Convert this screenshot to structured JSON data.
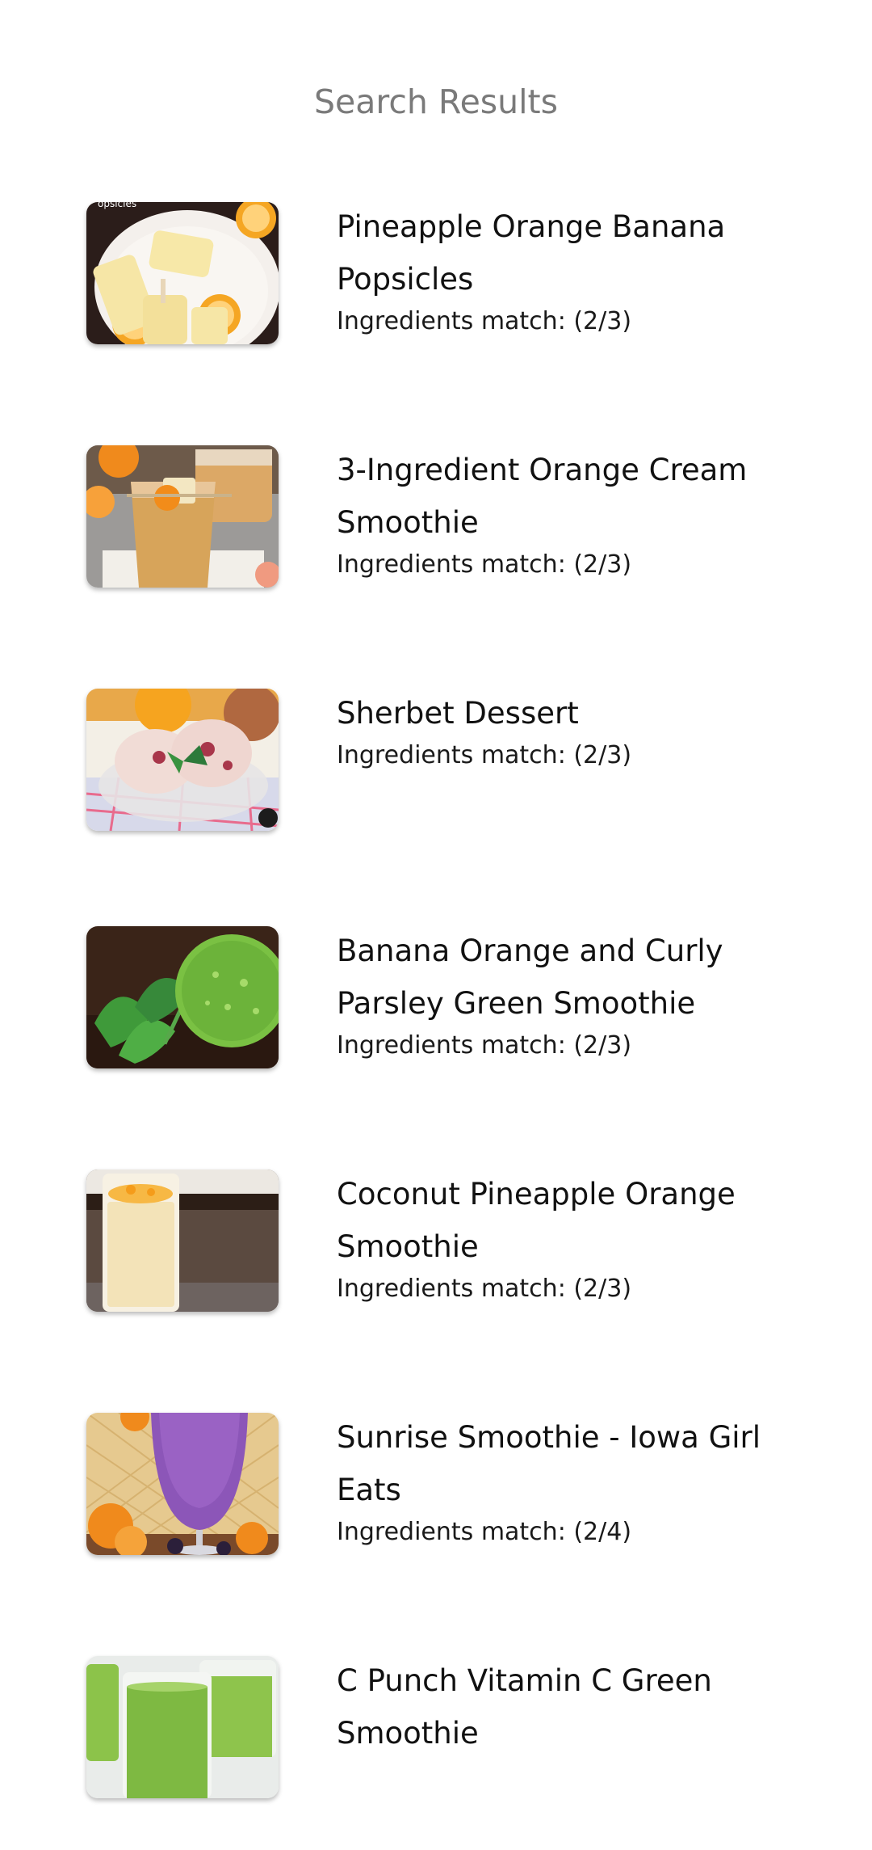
{
  "header": {
    "title": "Search Results"
  },
  "results": [
    {
      "title": "Pineapple Orange Banana Popsicles",
      "match": "Ingredients match: (2/3)",
      "image_icon": "popsicles-photo"
    },
    {
      "title": "3-Ingredient Orange Cream Smoothie",
      "match": "Ingredients match: (2/3)",
      "image_icon": "orange-smoothie-photo"
    },
    {
      "title": "Sherbet Dessert",
      "match": "Ingredients match: (2/3)",
      "image_icon": "sherbet-photo"
    },
    {
      "title": "Banana Orange and Curly Parsley Green Smoothie",
      "match": "Ingredients match: (2/3)",
      "image_icon": "green-smoothie-photo"
    },
    {
      "title": "Coconut Pineapple Orange Smoothie",
      "match": "Ingredients match: (2/3)",
      "image_icon": "coconut-smoothie-photo"
    },
    {
      "title": "Sunrise Smoothie - Iowa Girl Eats",
      "match": "Ingredients match: (2/4)",
      "image_icon": "purple-smoothie-photo"
    },
    {
      "title": "C Punch Vitamin C Green Smoothie",
      "match": "",
      "image_icon": "green-juice-photo"
    }
  ],
  "colors": {
    "title_text": "#7a7a7a",
    "item_text": "#111111",
    "background": "#ffffff"
  }
}
